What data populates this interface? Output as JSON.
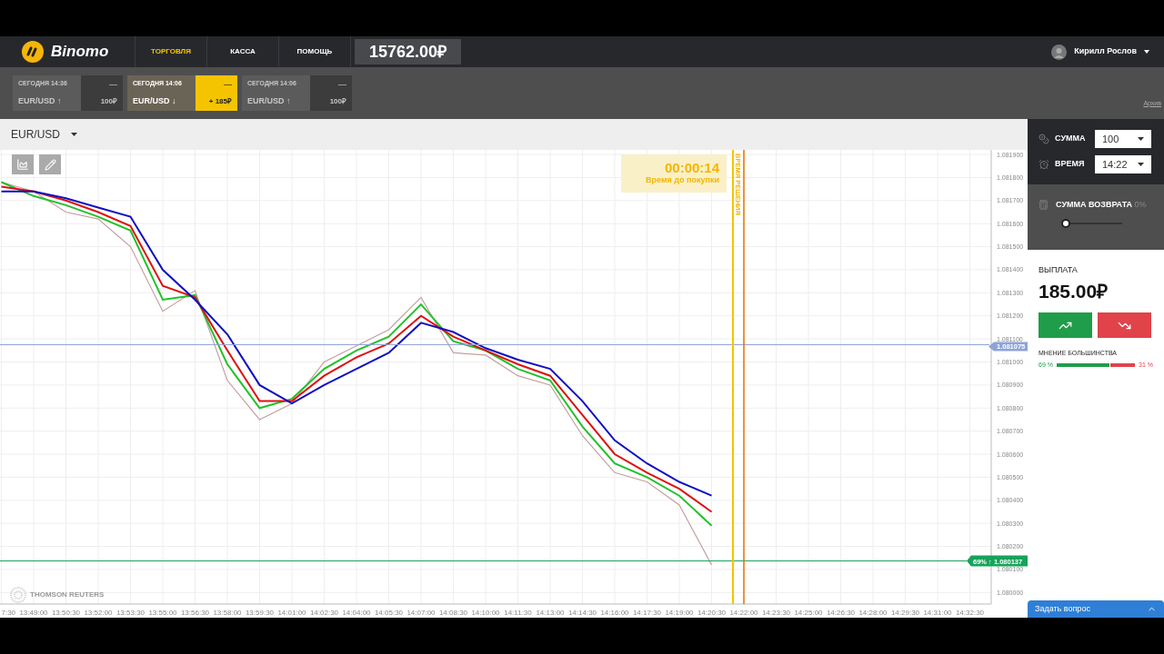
{
  "header": {
    "logo": "Binomo",
    "nav": [
      {
        "label": "ТОРГОВЛЯ",
        "selected": true
      },
      {
        "label": "КАССА",
        "selected": false
      },
      {
        "label": "ПОМОЩЬ",
        "selected": false
      }
    ],
    "balance": "15762.00₽",
    "user": "Кирилл Рослов"
  },
  "deals": [
    {
      "time": "СЕГОДНЯ 14:36",
      "pair": "EUR/USD",
      "arrow": "↑",
      "result": "—",
      "amount": "100₽",
      "selected": false
    },
    {
      "time": "СЕГОДНЯ 14:06",
      "pair": "EUR/USD",
      "arrow": "↓",
      "result": "—",
      "amount": "+ 185₽",
      "selected": true
    },
    {
      "time": "СЕГОДНЯ 14:06",
      "pair": "EUR/USD",
      "arrow": "↑",
      "result": "—",
      "amount": "100₽",
      "selected": false
    }
  ],
  "archive_link": "Архив",
  "asset": "EUR/USD",
  "countdown": {
    "time": "00:00:14",
    "label": "Время до покупки"
  },
  "source": "THOMSON REUTERS",
  "chart_data": {
    "type": "line",
    "grid": true,
    "categories": [
      "7:30",
      "13:49:00",
      "13:50:30",
      "13:52:00",
      "13:53:30",
      "13:55:00",
      "13:56:30",
      "13:58:00",
      "13:59:30",
      "14:01:00",
      "14:02:30",
      "14:04:00",
      "14:05:30",
      "14:07:00",
      "14:08:30",
      "14:10:00",
      "14:11:30",
      "14:13:00",
      "14:14:30",
      "14:16:00",
      "14:17:30",
      "14:19:00",
      "14:20:30",
      "14:22:00",
      "14:23:30",
      "14:25:00",
      "14:26:30",
      "14:28:00",
      "14:29:30",
      "14:31:00",
      "14:32:30"
    ],
    "series": [
      {
        "color": "#c4a0a0",
        "values": [
          1.08178,
          1.08174,
          1.08165,
          1.08162,
          1.0815,
          1.08122,
          1.08131,
          1.08092,
          1.08075,
          1.08082,
          1.081,
          1.08107,
          1.08114,
          1.08128,
          1.08104,
          1.08103,
          1.08094,
          1.0809,
          1.08068,
          1.08052,
          1.08048,
          1.08038,
          1.08012,
          null,
          null,
          null,
          null,
          null,
          null,
          null,
          null
        ]
      },
      {
        "color": "#22c02a",
        "values": [
          1.08178,
          1.08172,
          1.08168,
          1.08163,
          1.08157,
          1.08127,
          1.08129,
          1.08099,
          1.0808,
          1.08084,
          1.08097,
          1.08105,
          1.08111,
          1.08125,
          1.08109,
          1.08105,
          1.08097,
          1.08092,
          1.08072,
          1.08056,
          1.0805,
          1.08042,
          1.08029,
          null,
          null,
          null,
          null,
          null,
          null,
          null,
          null
        ]
      },
      {
        "color": "#e01010",
        "values": [
          1.08176,
          1.08174,
          1.0817,
          1.08165,
          1.08159,
          1.08133,
          1.08128,
          1.08105,
          1.08083,
          1.08083,
          1.08094,
          1.08102,
          1.08108,
          1.0812,
          1.08111,
          1.08105,
          1.08099,
          1.08094,
          1.08077,
          1.0806,
          1.08052,
          1.08045,
          1.08035,
          null,
          null,
          null,
          null,
          null,
          null,
          null,
          null
        ]
      },
      {
        "color": "#1010c0",
        "values": [
          1.08174,
          1.08174,
          1.08171,
          1.08167,
          1.08163,
          1.0814,
          1.08127,
          1.08112,
          1.0809,
          1.08082,
          1.0809,
          1.08097,
          1.08104,
          1.08117,
          1.08113,
          1.08106,
          1.08101,
          1.08097,
          1.08083,
          1.08066,
          1.08056,
          1.08048,
          1.08042,
          null,
          null,
          null,
          null,
          null,
          null,
          null,
          null
        ]
      }
    ],
    "ylim": [
      1.07995,
      1.08192
    ],
    "yticks": [
      {
        "value": 1.0819,
        "label": "1.081900"
      },
      {
        "value": 1.0818,
        "label": "1.081800"
      },
      {
        "value": 1.0817,
        "label": "1.081700"
      },
      {
        "value": 1.0816,
        "label": "1.081600"
      },
      {
        "value": 1.0815,
        "label": "1.081500"
      },
      {
        "value": 1.0814,
        "label": "1.081400"
      },
      {
        "value": 1.0813,
        "label": "1.081300"
      },
      {
        "value": 1.0812,
        "label": "1.081200"
      },
      {
        "value": 1.0811,
        "label": "1.081100"
      },
      {
        "value": 1.081,
        "label": "1.081000"
      },
      {
        "value": 1.0809,
        "label": "1.080900"
      },
      {
        "value": 1.0808,
        "label": "1.080800"
      },
      {
        "value": 1.0807,
        "label": "1.080700"
      },
      {
        "value": 1.0806,
        "label": "1.080600"
      },
      {
        "value": 1.0805,
        "label": "1.080500"
      },
      {
        "value": 1.0804,
        "label": "1.080400"
      },
      {
        "value": 1.0803,
        "label": "1.080300"
      },
      {
        "value": 1.0802,
        "label": "1.080200"
      },
      {
        "value": 1.0801,
        "label": "1.080100"
      },
      {
        "value": 1.08,
        "label": "1.080000"
      }
    ],
    "ref_lines": [
      {
        "axis": "y",
        "value": 1.081075,
        "color": "#8fa3d9",
        "label": "1.081075"
      },
      {
        "axis": "y",
        "value": 1.080137,
        "color": "#16a35a",
        "label": "69% ↑ 1.080137"
      },
      {
        "axis": "x",
        "value": "14:22:00",
        "color": "#e87000"
      }
    ]
  },
  "deadline_label": "ВРЕМЯ РЕШЕНИЯ",
  "panel": {
    "amount": {
      "label": "СУММА",
      "value": "100"
    },
    "time": {
      "label": "ВРЕМЯ",
      "value": "14:22"
    },
    "refund": {
      "label": "СУММА ВОЗВРАТА",
      "percent": "0%",
      "level": 0
    },
    "payout": {
      "label": "ВЫПЛАТА",
      "value": "185.00₽"
    },
    "opinion": {
      "label": "МНЕНИЕ БОЛЬШИНСТВА",
      "up": "69 %",
      "down": "31 %",
      "level": 0.69
    }
  },
  "chat": "Задать вопрос"
}
